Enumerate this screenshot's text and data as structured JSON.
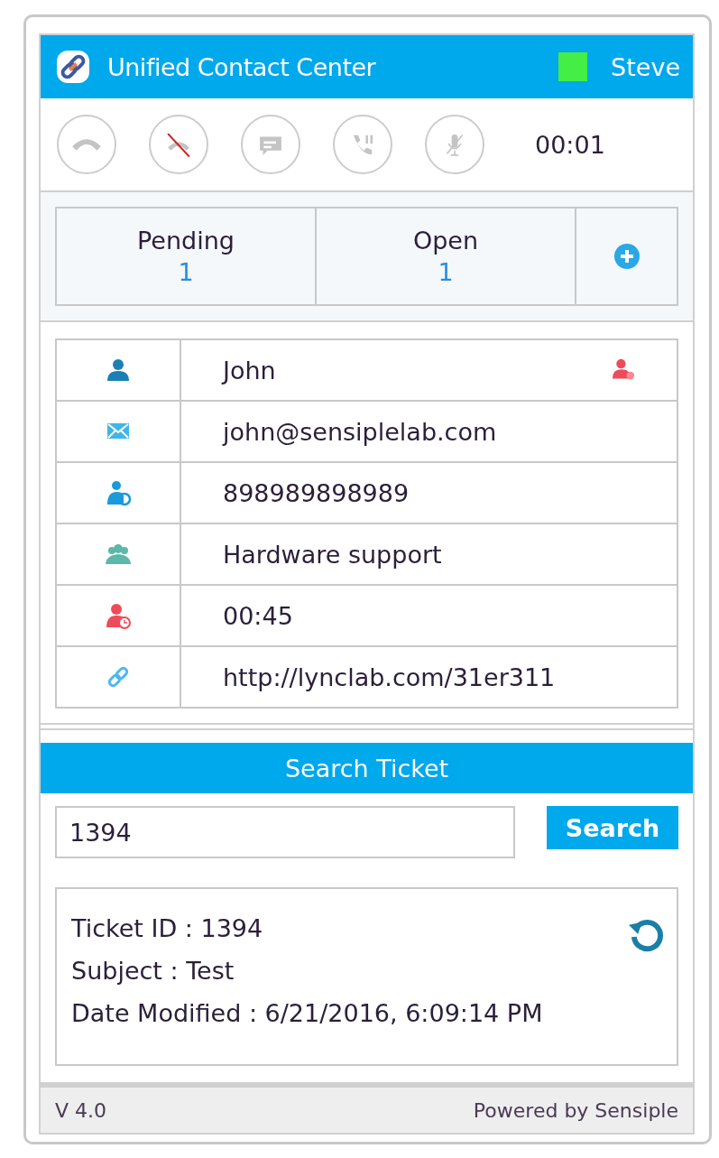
{
  "header": {
    "title": "Unified Contact Center",
    "status": {
      "color": "#44ee44"
    },
    "user": "Steve"
  },
  "call_controls": [
    {
      "kind": "hangup",
      "disabled": true
    },
    {
      "kind": "reject",
      "disabled": true
    },
    {
      "kind": "chat",
      "disabled": true
    },
    {
      "kind": "hold",
      "disabled": true
    },
    {
      "kind": "mute",
      "disabled": true
    }
  ],
  "call_timer": "00:01",
  "tabs": [
    {
      "label": "Pending",
      "count": "1",
      "selected": false
    },
    {
      "label": "Open",
      "count": "1",
      "selected": false
    }
  ],
  "contact": [
    {
      "kind": "name",
      "value": "John"
    },
    {
      "kind": "email",
      "value": "john@sensiplelab.com"
    },
    {
      "kind": "phone",
      "value": "898989898989"
    },
    {
      "kind": "group",
      "value": "Hardware support"
    },
    {
      "kind": "wait",
      "value": "00:45"
    },
    {
      "kind": "link",
      "value": "http://lynclab.com/31er311"
    }
  ],
  "search": {
    "title": "Search Ticket",
    "value": "1394",
    "button": "Search"
  },
  "ticket": [
    "Ticket ID : 1394",
    "Subject : Test",
    "Date Modified : 6/21/2016, 6:09:14 PM"
  ],
  "footer": {
    "version": "V 4.0",
    "powered": "Powered by Sensiple"
  }
}
